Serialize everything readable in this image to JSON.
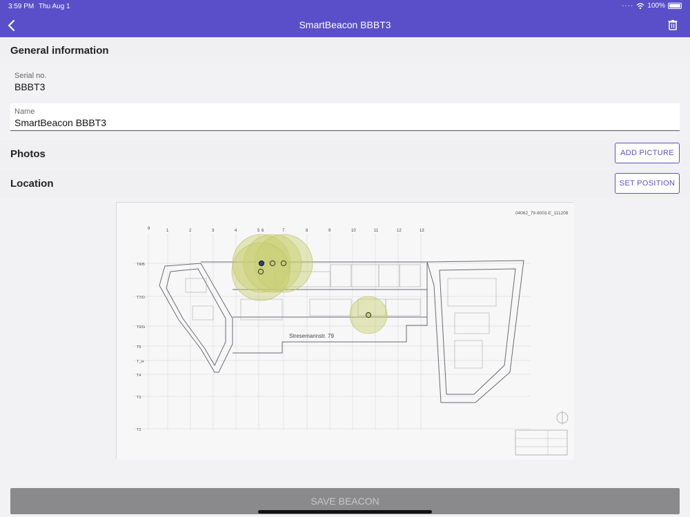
{
  "status_bar": {
    "time": "3:59 PM",
    "date": "Thu Aug 1",
    "battery": "100%",
    "icons": [
      "dots-icon",
      "wifi-icon",
      "battery-icon"
    ]
  },
  "nav": {
    "title": "SmartBeacon BBBT3",
    "back_icon": "chevron-left-icon",
    "delete_icon": "trash-icon"
  },
  "general": {
    "heading": "General information",
    "serial_label": "Serial no.",
    "serial_value": "BBBT3",
    "name_label": "Name",
    "name_value": "SmartBeacon BBBT3"
  },
  "photos": {
    "heading": "Photos",
    "button": "ADD PICTURE"
  },
  "location": {
    "heading": "Location",
    "button": "SET POSITION",
    "plan": {
      "drawing_id": "04062_79-8003-E_111208",
      "street_label": "Stresemannstr. 79",
      "column_labels": [
        "9",
        "1",
        "2",
        "3",
        "4",
        "5",
        "6",
        "7",
        "8",
        "9",
        "10",
        "11",
        "12",
        "13"
      ],
      "row_labels": [
        "T8/B",
        "T7/D",
        "T6/G",
        "T5",
        "T_H",
        "T4",
        "T3",
        "T2"
      ]
    }
  },
  "colors": {
    "accent": "#5a4fc8",
    "beacon_fill": "#c7ce6e",
    "beacon_selected": "#2a3f8f"
  },
  "footer": {
    "save": "SAVE BEACON"
  }
}
